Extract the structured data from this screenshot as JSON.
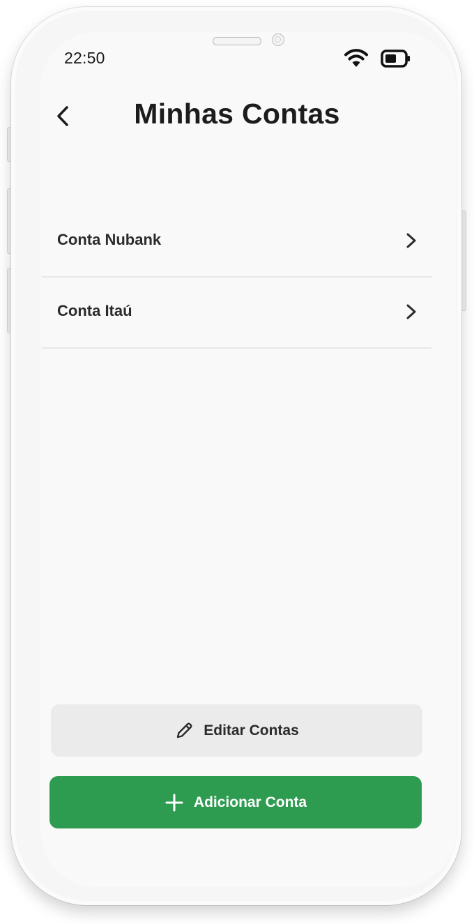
{
  "status_bar": {
    "time": "22:50",
    "wifi_icon": "wifi-icon",
    "battery_icon": "battery-icon"
  },
  "header": {
    "back_icon": "chevron-left-icon",
    "title": "Minhas Contas"
  },
  "accounts": [
    {
      "label": "Conta Nubank",
      "icon": "chevron-right-icon"
    },
    {
      "label": "Conta Itaú",
      "icon": "chevron-right-icon"
    }
  ],
  "actions": {
    "edit": {
      "label": "Editar Contas",
      "icon": "pencil-icon"
    },
    "add": {
      "label": "Adicionar Conta",
      "icon": "plus-icon"
    }
  },
  "colors": {
    "accent": "#2e9c50",
    "secondary_button": "#ebebeb",
    "background": "#f8f9f8"
  }
}
